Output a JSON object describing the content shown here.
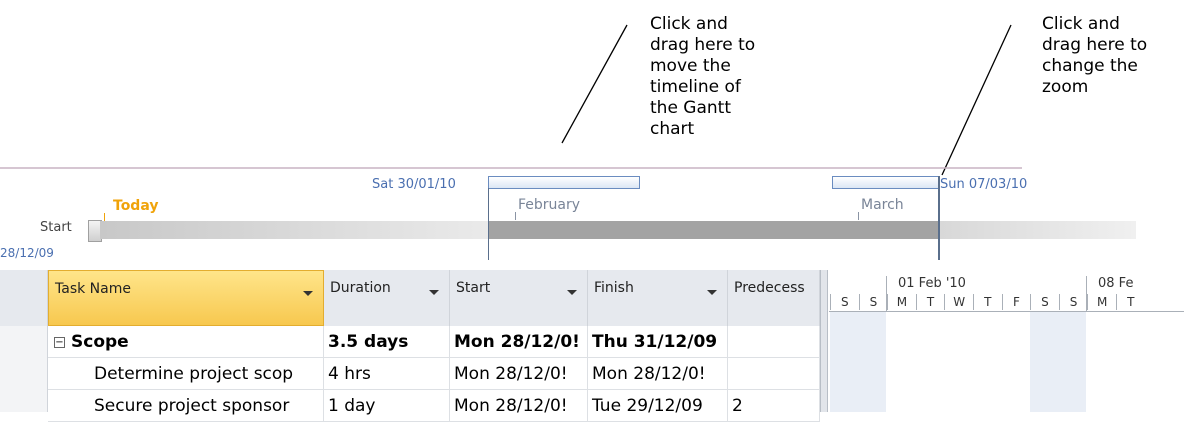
{
  "annotations": {
    "move": [
      "Click and",
      "drag here to",
      "move the",
      "timeline of",
      "the Gantt",
      "chart"
    ],
    "zoom": [
      "Click and",
      "drag here to",
      "change the",
      "zoom"
    ]
  },
  "timeline": {
    "left_date": "Sat 30/01/10",
    "right_date": "Sun 07/03/10",
    "today_label": "Today",
    "start_label": "Start",
    "start_date": "28/12/09",
    "months": [
      "February",
      "March"
    ]
  },
  "table": {
    "columns": [
      "Task Name",
      "Duration",
      "Start",
      "Finish",
      "Predecess"
    ],
    "rows": [
      {
        "name": "Scope",
        "duration": "3.5 days",
        "start": "Mon 28/12/0!",
        "finish": "Thu 31/12/09",
        "pred": "",
        "summary": true
      },
      {
        "name": "Determine project scop",
        "duration": "4 hrs",
        "start": "Mon 28/12/0!",
        "finish": "Mon 28/12/0!",
        "pred": ""
      },
      {
        "name": "Secure project sponsor",
        "duration": "1 day",
        "start": "Mon 28/12/0!",
        "finish": "Tue 29/12/09",
        "pred": "2"
      }
    ]
  },
  "gantt": {
    "weeks": [
      "01 Feb '10",
      "08 Fe"
    ],
    "days": [
      "S",
      "S",
      "M",
      "T",
      "W",
      "T",
      "F",
      "S",
      "S",
      "M",
      "T"
    ]
  },
  "colors": {
    "accent_blue": "#4a6fb0",
    "today_orange": "#f0a30a",
    "header_active": "#f7c84f"
  }
}
